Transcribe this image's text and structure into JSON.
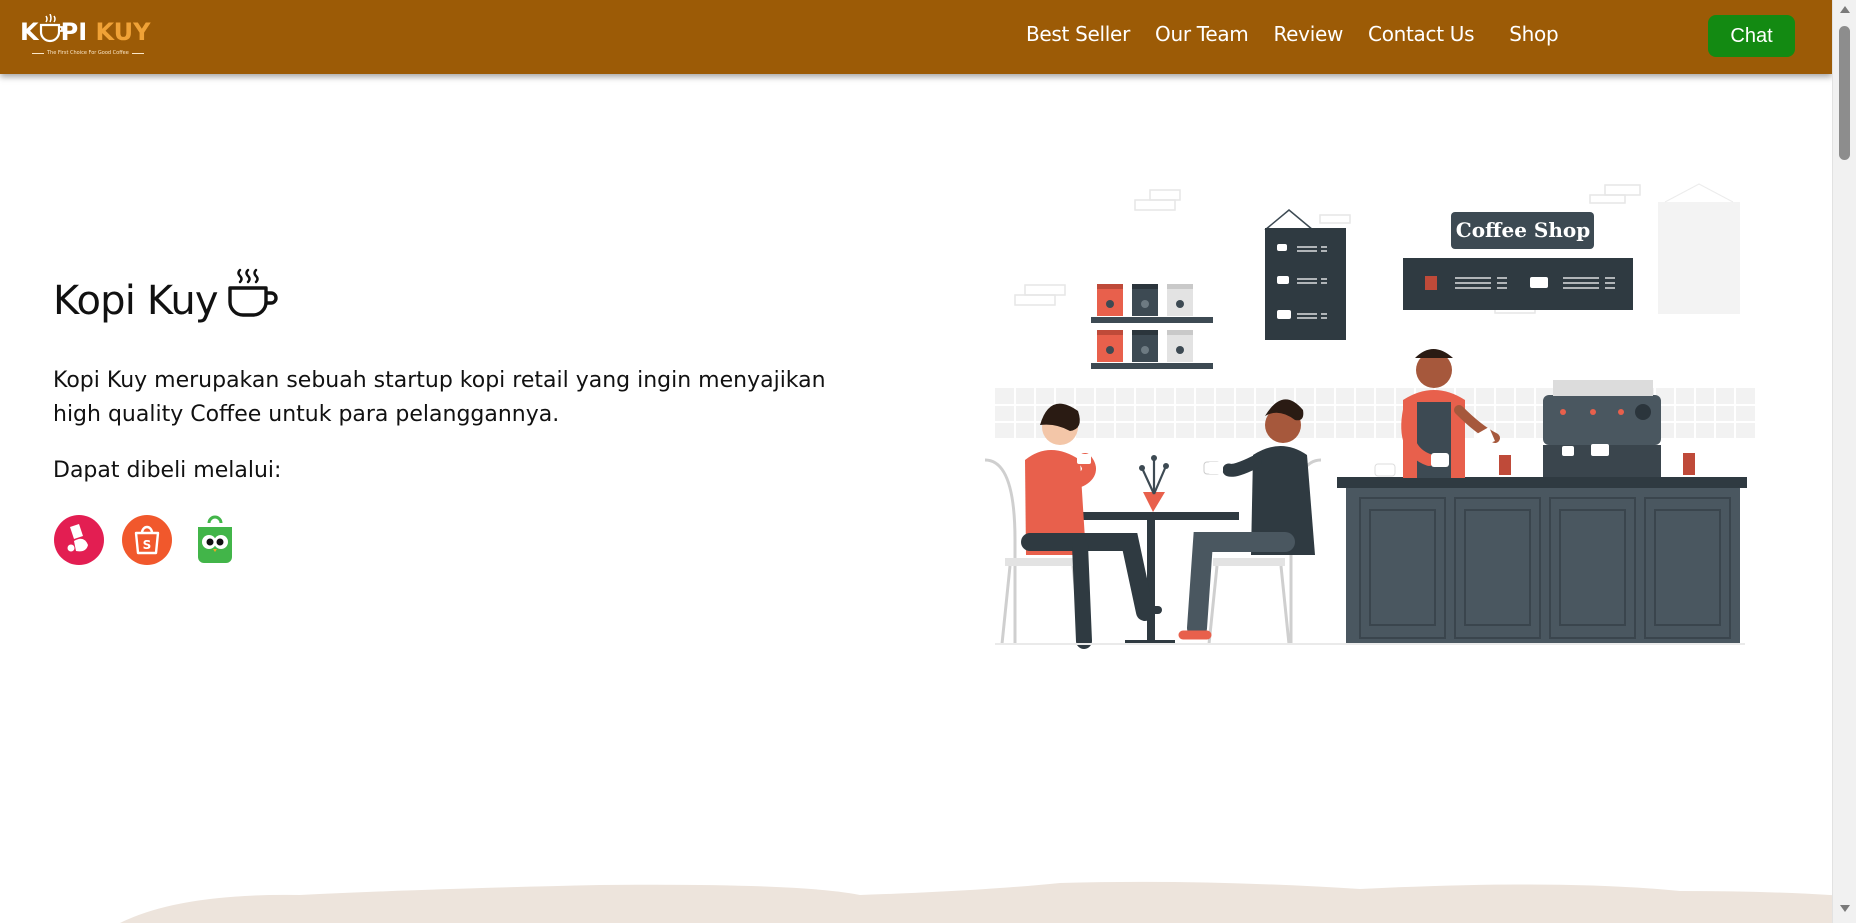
{
  "header": {
    "logo": {
      "word_left": "K",
      "word_mid": "PI ",
      "word_right": "KUY",
      "tagline": "The First Choice For Good Coffee"
    },
    "nav": [
      {
        "label": "Best Seller"
      },
      {
        "label": "Our Team"
      },
      {
        "label": "Review"
      },
      {
        "label": "Contact Us"
      },
      {
        "label": "Shop"
      }
    ],
    "chat_label": "Chat"
  },
  "hero": {
    "title": "Kopi Kuy",
    "title_icon": "coffee-cup-icon",
    "description": "Kopi Kuy merupakan sebuah startup kopi retail yang ingin menyajikan high quality Coffee untuk para pelanggannya.",
    "buy_label": "Dapat dibeli melalui:",
    "marketplaces": [
      {
        "name": "bukalapak-icon",
        "color": "#e31e52"
      },
      {
        "name": "shopee-icon",
        "color": "#f1582c"
      },
      {
        "name": "tokopedia-icon",
        "color": "#42b549"
      }
    ]
  },
  "illustration": {
    "sign_text": "Coffee Shop"
  },
  "colors": {
    "navbar": "#9c5b06",
    "chat_button": "#138a12",
    "accent_orange": "#f0a236"
  }
}
